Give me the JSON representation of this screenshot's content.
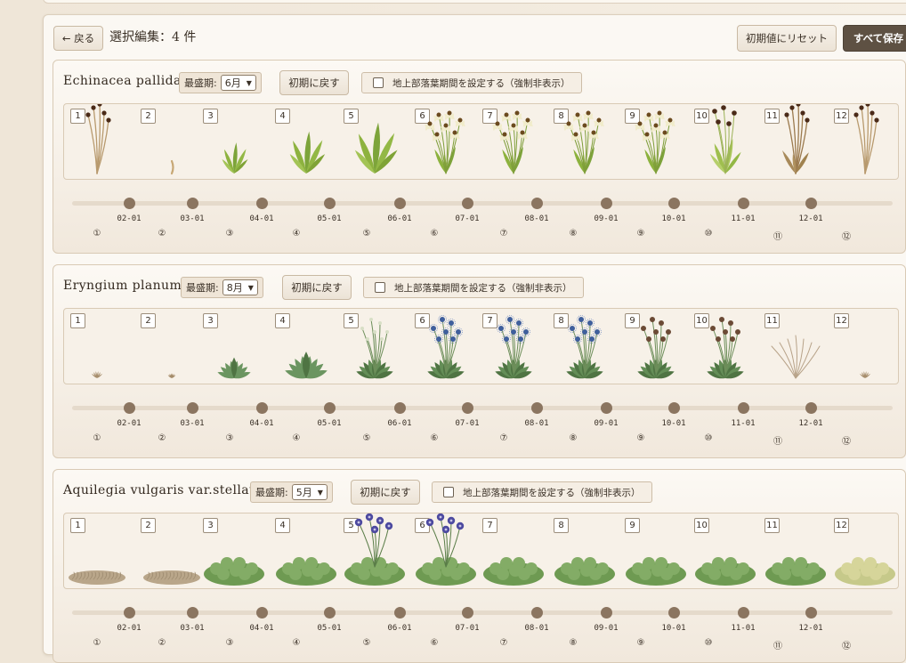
{
  "header": {
    "back_label": "← 戻る",
    "title": "選択編集：4 件",
    "reset_all_label": "初期値にリセット",
    "save_all_label": "すべて保存"
  },
  "months": [
    "1",
    "2",
    "3",
    "4",
    "5",
    "6",
    "7",
    "8",
    "9",
    "10",
    "11",
    "12"
  ],
  "timeline": {
    "dates": [
      "02-01",
      "03-01",
      "04-01",
      "05-01",
      "06-01",
      "07-01",
      "08-01",
      "09-01",
      "10-01",
      "11-01",
      "12-01"
    ],
    "circled": [
      "①",
      "②",
      "③",
      "④",
      "⑤",
      "⑥",
      "⑦",
      "⑧",
      "⑨",
      "⑩",
      "⑪",
      "⑫"
    ]
  },
  "cards": [
    {
      "species": "Echinacea pallida",
      "peak_label": "最盛期:",
      "peak_value": "6月",
      "reset_label": "初期に戻す",
      "dormancy_label": "地上部落葉期間を設定する（強制非表示）",
      "dormancy_checked": false
    },
    {
      "species": "Eryngium planum",
      "peak_label": "最盛期:",
      "peak_value": "8月",
      "reset_label": "初期に戻す",
      "dormancy_label": "地上部落葉期間を設定する（強制非表示）",
      "dormancy_checked": false
    },
    {
      "species": "Aquilegia vulgaris var.stellata",
      "peak_label": "最盛期:",
      "peak_value": "5月",
      "reset_label": "初期に戻す",
      "dormancy_label": "地上部落葉期間を設定する（強制非表示）",
      "dormancy_checked": false
    }
  ],
  "colors": {
    "accent_dark": "#5e5143",
    "leaf_green": "#7da43a",
    "flower_cream": "#f1eccb",
    "seedhead_brown": "#4a2a18",
    "thistle_blue": "#3f5f9c",
    "aquilegia_violet": "#4d4aa0",
    "foliage_green": "#6e9a52",
    "dormant_tan": "#b9a68a"
  }
}
